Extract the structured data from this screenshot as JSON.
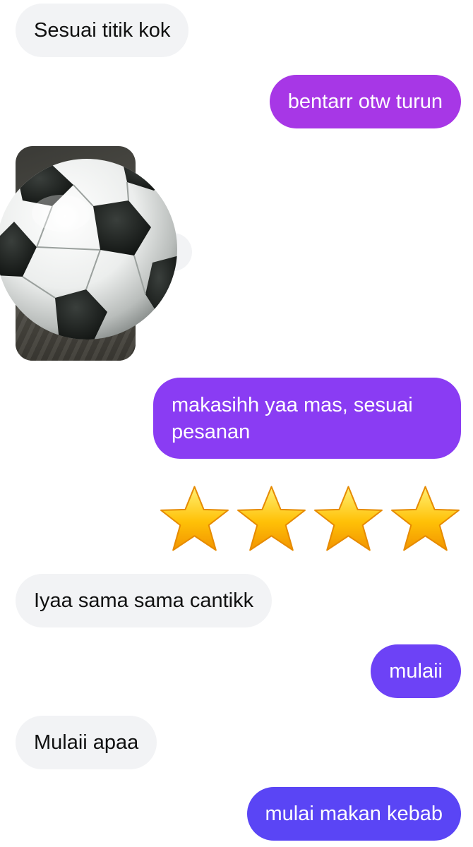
{
  "messages": [
    {
      "id": "m1",
      "direction": "incoming",
      "text": "Sesuai titik kok"
    },
    {
      "id": "m2",
      "direction": "outgoing",
      "text": "bentarr otw turun"
    },
    {
      "id": "m3",
      "direction": "incoming",
      "type": "photo",
      "icon": "soccer-ball-icon"
    },
    {
      "id": "m4",
      "direction": "outgoing",
      "text": "makasihh yaa mas, sesuai pesanan"
    },
    {
      "id": "m5",
      "direction": "outgoing",
      "type": "emoji",
      "emoji": "⭐⭐⭐⭐",
      "star_count": 4,
      "icon": "star-icon"
    },
    {
      "id": "m6",
      "direction": "incoming",
      "text": "Iyaa sama sama cantikk"
    },
    {
      "id": "m7",
      "direction": "outgoing",
      "text": "mulaii"
    },
    {
      "id": "m8",
      "direction": "incoming",
      "text": "Mulaii apaa"
    },
    {
      "id": "m9",
      "direction": "outgoing",
      "text": "mulai makan kebab"
    }
  ],
  "colors": {
    "incoming_bubble": "#f2f3f5",
    "incoming_text": "#111111",
    "outgoing_text": "#ffffff",
    "outgoing_gradient": [
      "#a737e6",
      "#8a3cf3",
      "#6d42f6",
      "#5a45f5"
    ],
    "star_fill": "#ffc107",
    "star_edge": "#f29400"
  }
}
